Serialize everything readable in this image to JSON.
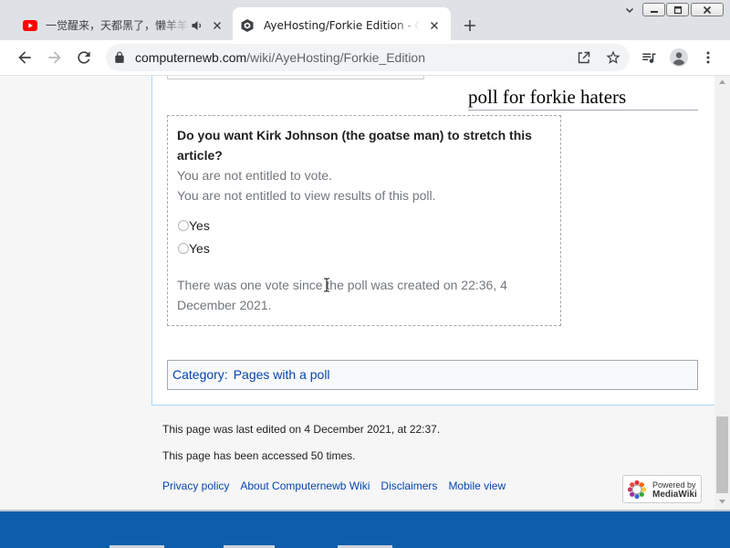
{
  "theme": {
    "tabstrip_bg": "#dee1e6",
    "page_bg": "#f6f6f6",
    "link": "#0645ad",
    "muted_text": "#72777d",
    "desktop_blue": "#0c5dab"
  },
  "browser": {
    "tabs": [
      {
        "title": "一觉醒来，天都黑了，懒羊羊",
        "icon": "youtube-icon",
        "indicator_icon": "speaker-icon",
        "active": false
      },
      {
        "title": "AyeHosting/Forkie Edition - Com",
        "icon": "computernewb-favicon-icon",
        "active": true
      }
    ],
    "address": {
      "host": "computernewb.com",
      "path": "/wiki/AyeHosting/Forkie_Edition"
    }
  },
  "page": {
    "section_heading": "poll for forkie haters",
    "poll": {
      "question": "Do you want Kirk Johnson (the goatse man) to stretch this article?",
      "notice_vote": "You are not entitled to vote.",
      "notice_results": "You are not entitled to view results of this poll.",
      "options": [
        "Yes",
        "Yes"
      ],
      "summary": "There was one vote since the poll was created on 22:36, 4 December 2021."
    },
    "categories": {
      "label": "Category:",
      "items": [
        "Pages with a poll"
      ]
    }
  },
  "footer": {
    "last_edited": "This page was last edited on 4 December 2021, at 22:37.",
    "accessed": "This page has been accessed 50 times.",
    "links": [
      "Privacy policy",
      "About Computernewb Wiki",
      "Disclaimers",
      "Mobile view"
    ],
    "powered_by": {
      "line1": "Powered by",
      "line2": "MediaWiki"
    }
  }
}
